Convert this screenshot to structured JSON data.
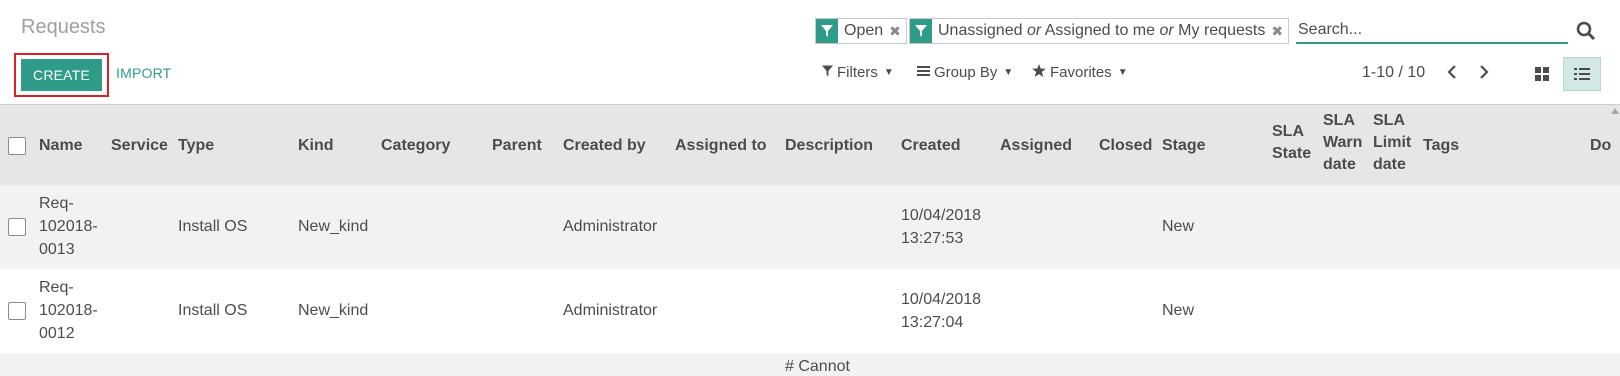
{
  "header": {
    "title": "Requests",
    "create_label": "CREATE",
    "import_label": "IMPORT"
  },
  "search": {
    "facets": [
      {
        "icon": "filter-icon",
        "label": "Open"
      },
      {
        "icon": "filter-icon",
        "parts": [
          "Unassigned",
          "or",
          "Assigned to me",
          "or",
          "My requests"
        ]
      }
    ],
    "placeholder": "Search..."
  },
  "dropdowns": {
    "filters": "Filters",
    "group_by": "Group By",
    "favorites": "Favorites"
  },
  "pager": {
    "value": "1-10 / 10"
  },
  "table": {
    "columns": {
      "name": "Name",
      "service": "Service",
      "type": "Type",
      "kind": "Kind",
      "category": "Category",
      "parent": "Parent",
      "created_by": "Created by",
      "assigned_to": "Assigned to",
      "description": "Description",
      "created": "Created",
      "assigned": "Assigned",
      "closed": "Closed",
      "stage": "Stage",
      "sla_state": [
        "SLA",
        "State"
      ],
      "sla_warn": [
        "SLA",
        "Warn",
        "date"
      ],
      "sla_limit": [
        "SLA",
        "Limit",
        "date"
      ],
      "tags": "Tags",
      "do": "Do"
    },
    "rows": [
      {
        "name": [
          "Req-",
          "102018-",
          "0013"
        ],
        "type": "Install OS",
        "kind": "New_kind",
        "created_by": "Administrator",
        "created": [
          "10/04/2018",
          "13:27:53"
        ],
        "stage": "New"
      },
      {
        "name": [
          "Req-",
          "102018-",
          "0012"
        ],
        "type": "Install OS",
        "kind": "New_kind",
        "created_by": "Administrator",
        "created": [
          "10/04/2018",
          "13:27:04"
        ],
        "stage": "New"
      }
    ],
    "footer_text": "# Cannot"
  },
  "colors": {
    "accent": "#2f9c8a",
    "highlight_box": "#e02020"
  }
}
